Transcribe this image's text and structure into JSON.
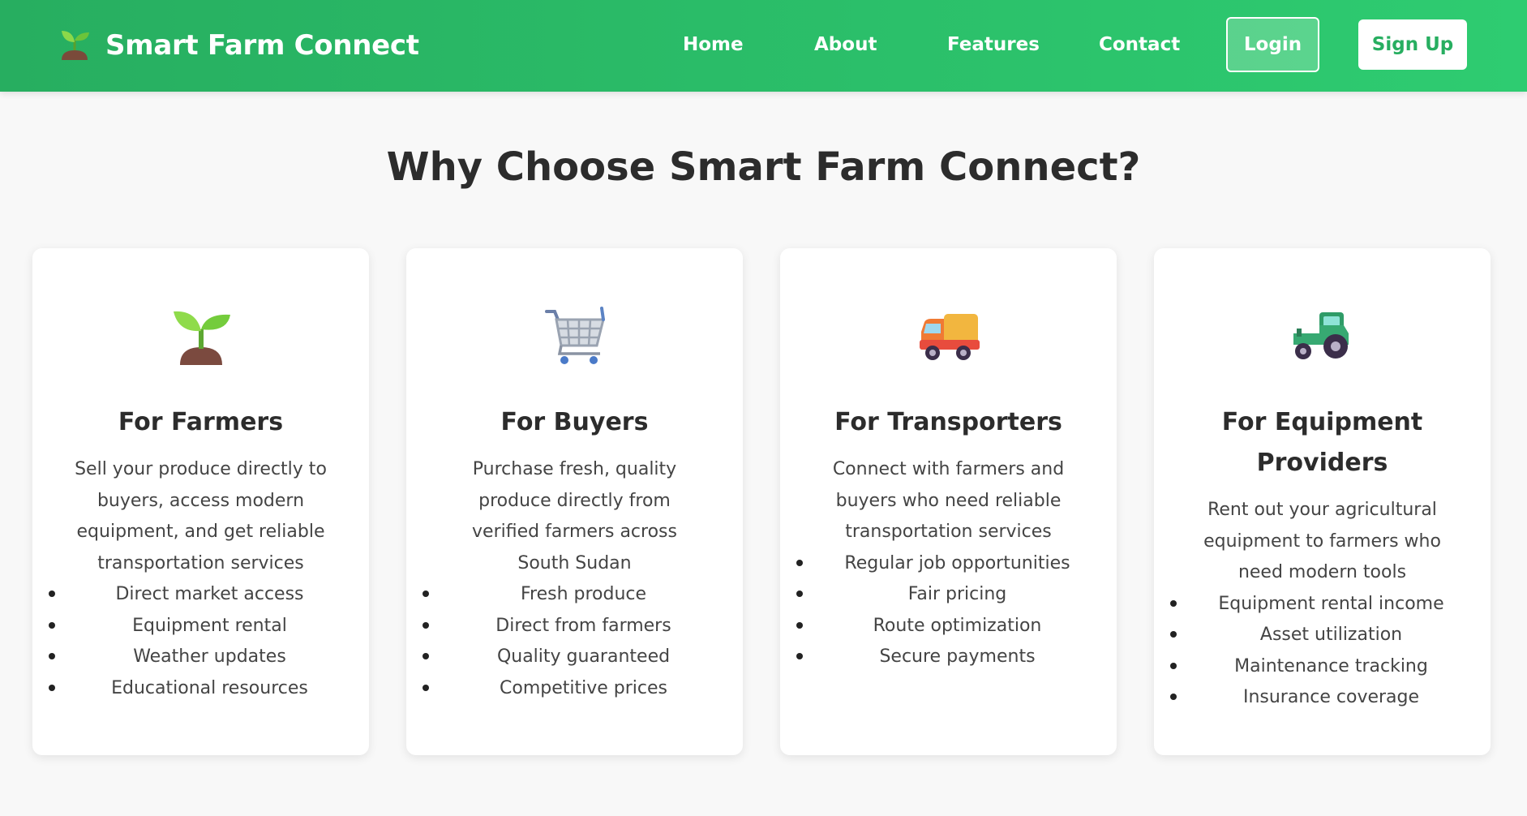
{
  "header": {
    "brand_name": "Smart Farm Connect",
    "brand_icon": "seedling-icon",
    "nav": {
      "home": "Home",
      "about": "About",
      "features": "Features",
      "contact": "Contact"
    },
    "login_label": "Login",
    "signup_label": "Sign Up",
    "accent_color": "#2ecc71"
  },
  "main": {
    "title": "Why Choose Smart Farm Connect?",
    "cards": [
      {
        "icon": "seedling-icon",
        "title": "For Farmers",
        "description": "Sell your produce directly to buyers, access modern equipment, and get reliable transportation services",
        "items": [
          "Direct market access",
          "Equipment rental",
          "Weather updates",
          "Educational resources"
        ]
      },
      {
        "icon": "shopping-cart-icon",
        "title": "For Buyers",
        "description": "Purchase fresh, quality produce directly from verified farmers across South Sudan",
        "items": [
          "Fresh produce",
          "Direct from farmers",
          "Quality guaranteed",
          "Competitive prices"
        ]
      },
      {
        "icon": "delivery-truck-icon",
        "title": "For Transporters",
        "description": "Connect with farmers and buyers who need reliable transportation services",
        "items": [
          "Regular job opportunities",
          "Fair pricing",
          "Route optimization",
          "Secure payments"
        ]
      },
      {
        "icon": "tractor-icon",
        "title": "For Equipment Providers",
        "description": "Rent out your agricultural equipment to farmers who need modern tools",
        "items": [
          "Equipment rental income",
          "Asset utilization",
          "Maintenance tracking",
          "Insurance coverage"
        ]
      }
    ]
  }
}
